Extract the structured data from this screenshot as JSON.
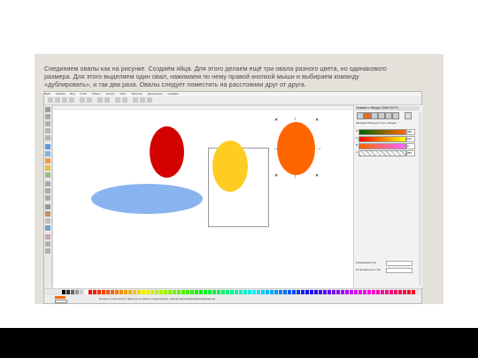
{
  "caption": {
    "line1": "Соединяем овалы как на рисунке. Создаём яйца. Для этого делаем ещё три овала разного цвета, но одинакового",
    "line2": "размера. Для этого выделяем один овал, нажимаем по нему правой кнопкой мыши и выбираем команду",
    "line3": "«дублировать», и так два раза. Овалы следует поместить на расстоянии друг от друга."
  },
  "app": {
    "menu_items": [
      "Файл",
      "Правка",
      "Вид",
      "Слой",
      "Объект",
      "Контур",
      "Текст",
      "Фильтры",
      "Дополнения",
      "Справка"
    ],
    "dock_title": "Заливка и обводка (Shift+Ctrl+F)",
    "dock_tabs": [
      "Заливка",
      "Обводка",
      "Стиль обводки"
    ],
    "rgba_rows": [
      {
        "label": "R",
        "value": "255"
      },
      {
        "label": "G",
        "value": "102"
      },
      {
        "label": "B",
        "value": "0"
      },
      {
        "label": "A",
        "value": "255"
      }
    ],
    "blur_label": "Размывание (%)",
    "opacity_label": "Непрозрачность (%)",
    "status_text": "Эллипс в слое Слой 1. Щелчок по объекту переключает стрелки масштабирования/вращения."
  },
  "colors": {
    "red_oval": "#d40000",
    "yellow_oval": "#ffcc22",
    "orange_oval": "#ff6600",
    "blue_plate": "#8ab4f0"
  }
}
